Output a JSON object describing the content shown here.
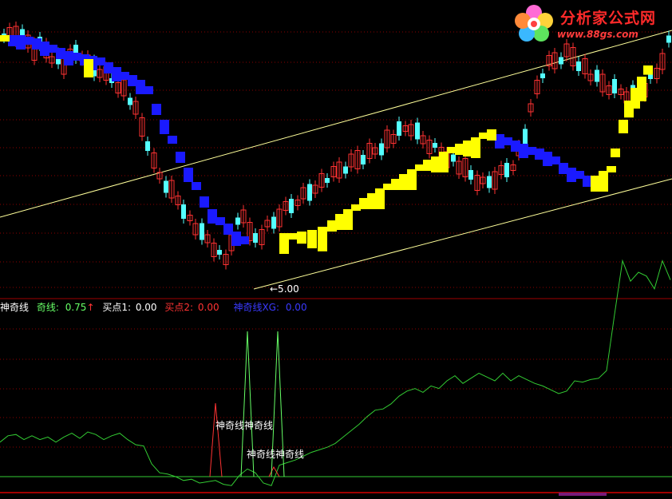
{
  "logo": {
    "name": "分析家公式网",
    "url": "www.88gs.com"
  },
  "price_label": "←5.00",
  "legend": {
    "indicator_name": "神奇线",
    "qx_label": "奇线:",
    "qx_value": "0.75",
    "qx_arrow": "↑",
    "buy1_label": "买点1:",
    "buy1_value": "0.00",
    "buy2_label": "买点2:",
    "buy2_value": "0.00",
    "xg_label": "神奇线XG:",
    "xg_value": "0.00"
  },
  "signal_labels": {
    "upper": "神奇线神奇线",
    "lower": "神奇线神奇线"
  },
  "colors": {
    "background": "#000000",
    "candle_up": "#ff3232",
    "candle_down": "#54ffff",
    "band_blue": "#1a1aff",
    "band_yellow": "#ffff00",
    "channel": "#ffff9a",
    "grid": "#8b0000",
    "indicator_line": "#33cc33",
    "spike_green": "#66ff66",
    "spike_red": "#ff3333"
  },
  "chart_data": [
    {
      "type": "candlestick",
      "description_series": "price",
      "price_marker": 5.0
    },
    {
      "type": "line",
      "series": [
        {
          "x": [
            0,
            10,
            20,
            30,
            40,
            50,
            60,
            70,
            80,
            90,
            100,
            110,
            120,
            130,
            140,
            150,
            160,
            170,
            180,
            190,
            200,
            210,
            220,
            230,
            240,
            250,
            260,
            270,
            280,
            290,
            300,
            310,
            320,
            330,
            340,
            350,
            360,
            370,
            380,
            390,
            400,
            410,
            420,
            430,
            440,
            450,
            460,
            470,
            480,
            490,
            500,
            510,
            520,
            530,
            540,
            550,
            560,
            570,
            580,
            590,
            600,
            610,
            620,
            630,
            640,
            650,
            660,
            670,
            680,
            690,
            700,
            710,
            720,
            730,
            740,
            750,
            760,
            770,
            780,
            790,
            800,
            810,
            820,
            830,
            840
          ],
          "values": [
            0.22,
            0.27,
            0.28,
            0.24,
            0.27,
            0.24,
            0.26,
            0.22,
            0.26,
            0.29,
            0.25,
            0.3,
            0.28,
            0.24,
            0.27,
            0.29,
            0.24,
            0.2,
            0.19,
            0.05,
            -0.02,
            -0.03,
            -0.05,
            -0.08,
            -0.07,
            -0.1,
            -0.09,
            -0.08,
            -0.11,
            -0.12,
            -0.04,
            0.01,
            -0.02,
            -0.1,
            -0.12,
            0.04,
            0.06,
            0.08,
            0.11,
            0.14,
            0.16,
            0.18,
            0.21,
            0.26,
            0.31,
            0.36,
            0.42,
            0.47,
            0.48,
            0.52,
            0.58,
            0.62,
            0.64,
            0.61,
            0.66,
            0.64,
            0.7,
            0.74,
            0.68,
            0.72,
            0.76,
            0.73,
            0.7,
            0.76,
            0.7,
            0.74,
            0.71,
            0.68,
            0.66,
            0.63,
            0.6,
            0.62,
            0.7,
            0.69,
            0.71,
            0.72,
            0.78,
            1.22,
            1.64,
            1.48,
            1.55,
            1.52,
            1.42,
            1.64,
            1.49
          ]
        }
      ]
    }
  ]
}
